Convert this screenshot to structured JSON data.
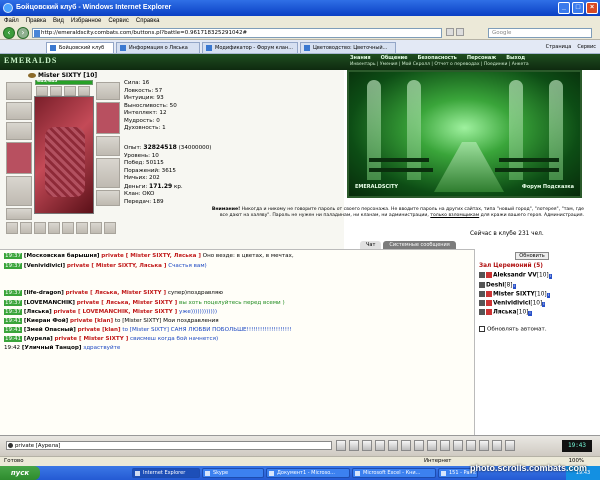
{
  "window": {
    "title": "Бойцовский клуб - Windows Internet Explorer"
  },
  "menu": [
    "Файл",
    "Правка",
    "Вид",
    "Избранное",
    "Сервис",
    "Справка"
  ],
  "address": {
    "url": "http://emeraldscity.combats.com/buttons.pl?battle=0.96171832529104​2#",
    "search_placeholder": "Google"
  },
  "tabs": [
    {
      "label": "Бойцовский клуб"
    },
    {
      "label": "Информация о Ляська"
    },
    {
      "label": "Модификатор - Форум клан..."
    },
    {
      "label": "Цветоводство: Цветочный..."
    }
  ],
  "tab_tools": {
    "page": "Страница",
    "tools": "Сервис"
  },
  "game": {
    "logo": "EMERALDS",
    "topnav": [
      "Знания",
      "Общение",
      "Безопасность",
      "Персонаж",
      "Выход"
    ],
    "subnav": "Инвентарь | Умения | Мой Скролл | Отчет о переводах | Поединки | Анкета",
    "character": {
      "name": "Mister SIXTY",
      "level": "[10]",
      "hp": "645/645",
      "stats": [
        "Сила: 16",
        "Ловкость: 57",
        "Интуиция: 93",
        "Выносливость: 50",
        "Интеллект: 12",
        "Мудрость: 0",
        "Духовность: 1"
      ],
      "exp_label": "Опыт:",
      "exp_value": "32824518",
      "exp_next": "(34000000)",
      "level_line": "Уровень: 10",
      "wins": "Побед: 50115",
      "losses": "Поражений: 3615",
      "draws": "Ничьих: 202",
      "money_label": "Деньги:",
      "money_value": "171.29",
      "money_unit": "кр.",
      "clan": "Клан: OKO",
      "transfers": "Передач: 189"
    },
    "scene": {
      "sign": "EMERALDSCITY",
      "links": "Форум  Подсказка"
    },
    "warning": {
      "title": "Внимание!",
      "text": "Никогда и никому не говорите пароль от своего персонажа. Не вводите пароль на других сайтах, типа \"новый город\", \"лотерея\", \"там, где все дают на халяву\". Пароль не нужен ни паладинам, ни кланам, ни администрации,",
      "link": "только взломщикам",
      "tail": "для кражи вашего героя. Администрация."
    },
    "online": "Сейчас в клубе 231 чел.",
    "chat_tabs": [
      "Чат",
      "Системные сообщения"
    ],
    "chat": [
      {
        "time": "19:37",
        "name": "[Московская барышня]",
        "priv": "private [ Mister SIXTY, Ляська ]",
        "msg": "Оно везде: в цветах, в мечтах,",
        "cls": "msg"
      },
      {
        "time": "19:37",
        "name": "[Venividivici]",
        "priv": "private [ Mister SIXTY, Ляська ]",
        "msg": "Счастья вам)",
        "cls": "msgb"
      },
      {
        "time": "19:37",
        "name": "[life-dragon]",
        "priv": "private [ Ляська, Mister SIXTY ]",
        "msg": "супер)поздравляю",
        "cls": "msg"
      },
      {
        "time": "19:37",
        "name": "[LOVEMANCHIK]",
        "priv": "private [ Ляська, Mister SIXTY ]",
        "msg": "вы хоть поцелуйтесь перед всеми )",
        "cls": "msgg"
      },
      {
        "time": "19:37",
        "name": "[Ляська]",
        "priv": "private [ LOVEMANCHIK, Mister SIXTY ]",
        "msg": "уже))))))))))))",
        "cls": "msgb"
      },
      {
        "time": "19:41",
        "name": "[Киеран Фой]",
        "priv": "private [klan]",
        "msg": "to [Mister SIXTY] Мои поздравления",
        "cls": "msg"
      },
      {
        "time": "19:41",
        "name": "[Змей Опасный]",
        "priv": "private [klan]",
        "msg": "to [Mister SIXTY] САНЯ ЛЮБВИ ПОБОЛЬШЕ!!!!!!!!!!!!!!!!!!!!",
        "cls": "msg"
      },
      {
        "time": "19:41",
        "name": "[Аурела]",
        "priv": "private [ Mister SIXTY ]",
        "msg": "свисмеш когда бой начнется)",
        "cls": "msgb"
      },
      {
        "time": "19:42",
        "name": "[Уличный Танцор]",
        "priv": "",
        "msg": "здраствуйте",
        "cls": "msgb"
      }
    ],
    "side": {
      "update_button": "Обновить",
      "room_title": "Зал Церемоний (5)",
      "users": [
        {
          "name": "Aleksandr VV",
          "level": "[10]"
        },
        {
          "name": "Deshi",
          "level": "[8]"
        },
        {
          "name": "Mister SIXTY",
          "level": "[10]"
        },
        {
          "name": "Venividivici",
          "level": "[10]"
        },
        {
          "name": "Ляська",
          "level": "[10]"
        }
      ],
      "auto_update": "Обновлять автомат."
    },
    "input": {
      "value": "private [Аурела]"
    },
    "clock": "19:43"
  },
  "statusbar": {
    "left": "Готово",
    "middle": "Интернет",
    "zoom": "100%"
  },
  "taskbar": {
    "start": "пуск",
    "items": [
      "Internet Explorer",
      "Skype",
      "Документ1 - Microso...",
      "Microsoft Excel - Кни...",
      "151 - Paint"
    ],
    "tray": "19:43"
  },
  "watermark": "photo.scrolls.combats.com",
  "colors": {
    "accent": "#1f4d1f",
    "private": "#c01818",
    "timestamp": "#3aa43a"
  }
}
